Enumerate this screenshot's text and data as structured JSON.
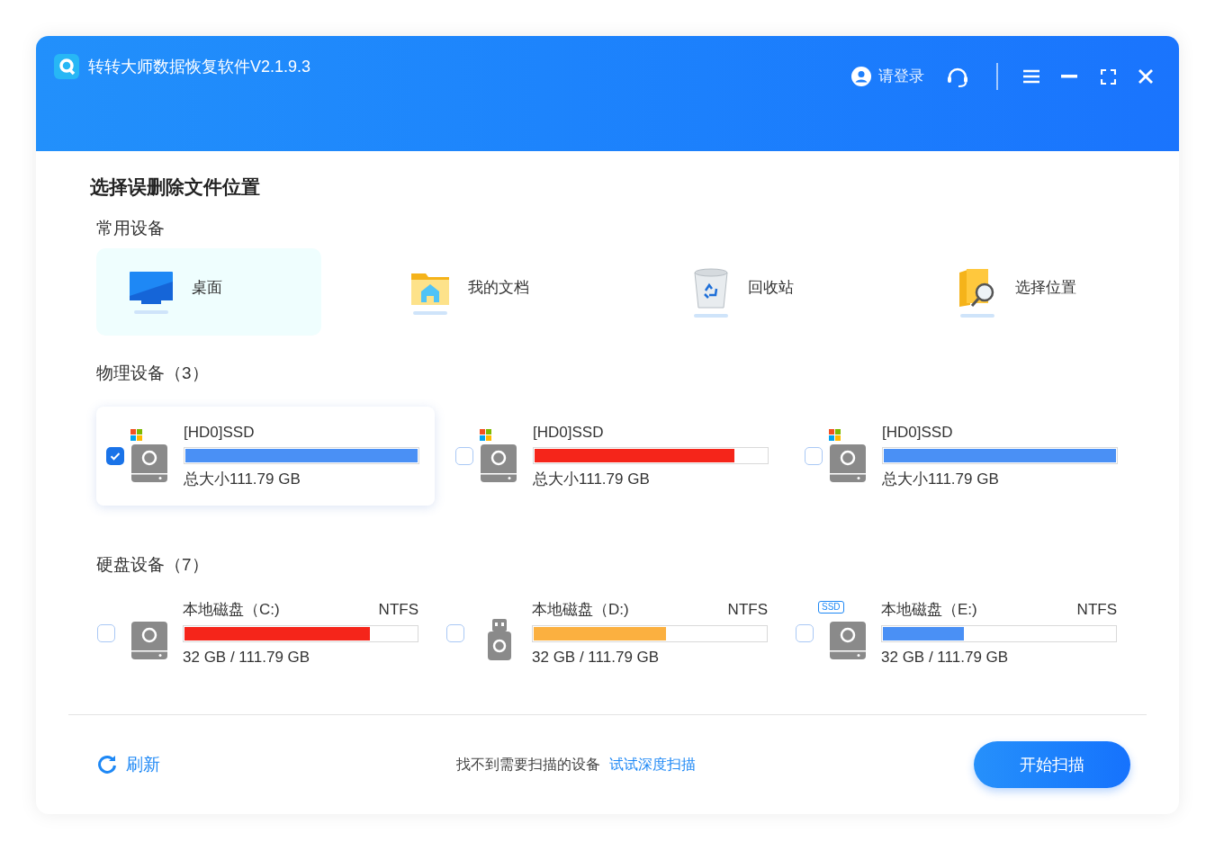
{
  "window": {
    "title": "转转大师数据恢复软件V2.1.9.3",
    "login": "请登录"
  },
  "heading": "选择误删除文件位置",
  "common": {
    "title": "常用设备",
    "items": [
      {
        "kind": "desktop",
        "label": "桌面",
        "selected": true
      },
      {
        "kind": "documents",
        "label": "我的文档",
        "selected": false
      },
      {
        "kind": "recycle",
        "label": "回收站",
        "selected": false
      },
      {
        "kind": "folder-search",
        "label": "选择位置",
        "selected": false
      }
    ]
  },
  "physical": {
    "title": "物理设备（3）",
    "items": [
      {
        "name": "[HD0]SSD",
        "size": "总大小111.79 GB",
        "level": 1,
        "color": "#4a90f5",
        "checked": true,
        "windows_logo": true
      },
      {
        "name": "[HD0]SSD",
        "size": "总大小111.79 GB",
        "level": 0.86,
        "color": "#f5251a",
        "checked": false,
        "windows_logo": true
      },
      {
        "name": "[HD0]SSD",
        "size": "总大小111.79 GB",
        "level": 1,
        "color": "#4a90f5",
        "checked": false,
        "windows_logo": true
      }
    ]
  },
  "disks": {
    "title": "硬盘设备（7）",
    "items": [
      {
        "kind": "hdd",
        "name": "本地磁盘（C:)",
        "fs": "NTFS",
        "usage": "32 GB / 111.79 GB",
        "level": 0.8,
        "color": "#f5251a",
        "checked": false
      },
      {
        "kind": "usb",
        "name": "本地磁盘（D:)",
        "fs": "NTFS",
        "usage": "32 GB / 111.79 GB",
        "level": 0.57,
        "color": "#fbb040",
        "checked": false
      },
      {
        "kind": "hdd",
        "tag": "SSD",
        "name": "本地磁盘（E:)",
        "fs": "NTFS",
        "usage": "32 GB / 111.79 GB",
        "level": 0.35,
        "color": "#4a90f5",
        "checked": false
      }
    ]
  },
  "footer": {
    "refresh": "刷新",
    "hint": "找不到需要扫描的设备",
    "link": "试试深度扫描",
    "start": "开始扫描"
  }
}
